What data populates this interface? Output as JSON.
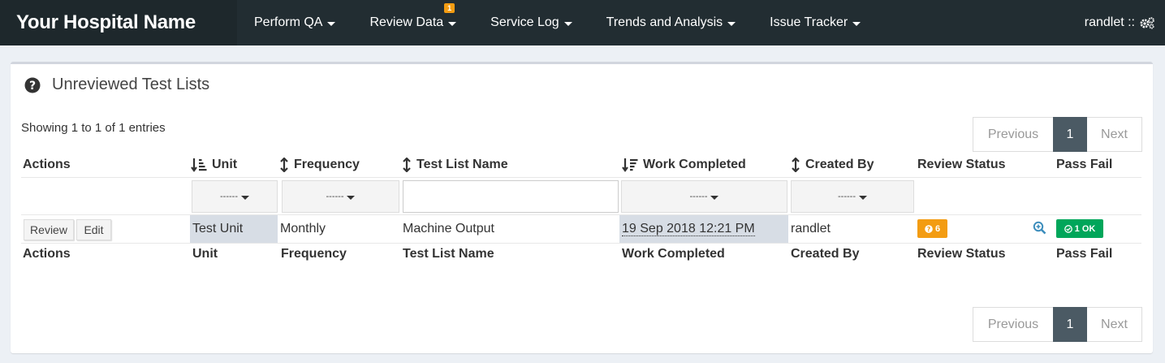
{
  "navbar": {
    "brand": "Your Hospital Name",
    "items": [
      {
        "label": "Perform QA"
      },
      {
        "label": "Review Data",
        "badge": "1"
      },
      {
        "label": "Service Log"
      },
      {
        "label": "Trends and Analysis"
      },
      {
        "label": "Issue Tracker"
      }
    ],
    "user": "randlet ::",
    "user_icon": "cogs-icon"
  },
  "box": {
    "title": "Unreviewed Test Lists",
    "title_icon": "question-circle-icon",
    "info": "Showing 1 to 1 of 1 entries"
  },
  "pagination": {
    "previous": "Previous",
    "current": "1",
    "next": "Next"
  },
  "table": {
    "headers": [
      "Actions",
      "Unit",
      "Frequency",
      "Test List Name",
      "Work Completed",
      "Created By",
      "Review Status",
      "Pass Fail"
    ],
    "filters": {
      "unit": "------",
      "frequency": "------",
      "work_completed": "------",
      "created_by": "------",
      "test_list_name_value": ""
    },
    "rows": [
      {
        "actions": [
          "Review",
          "Edit"
        ],
        "unit": "Test Unit",
        "frequency": "Monthly",
        "test_list_name": "Machine Output",
        "work_completed": "19 Sep 2018 12:21 PM",
        "created_by": "randlet",
        "review_status": "6",
        "pass_fail": "1 OK"
      }
    ]
  },
  "colors": {
    "navbar": "#222d32",
    "brand_bg": "#1e282c",
    "warning": "#f39c12",
    "success": "#00a65a",
    "pager_active": "#4b5a64",
    "sorted_cell": "#d7dde5"
  }
}
